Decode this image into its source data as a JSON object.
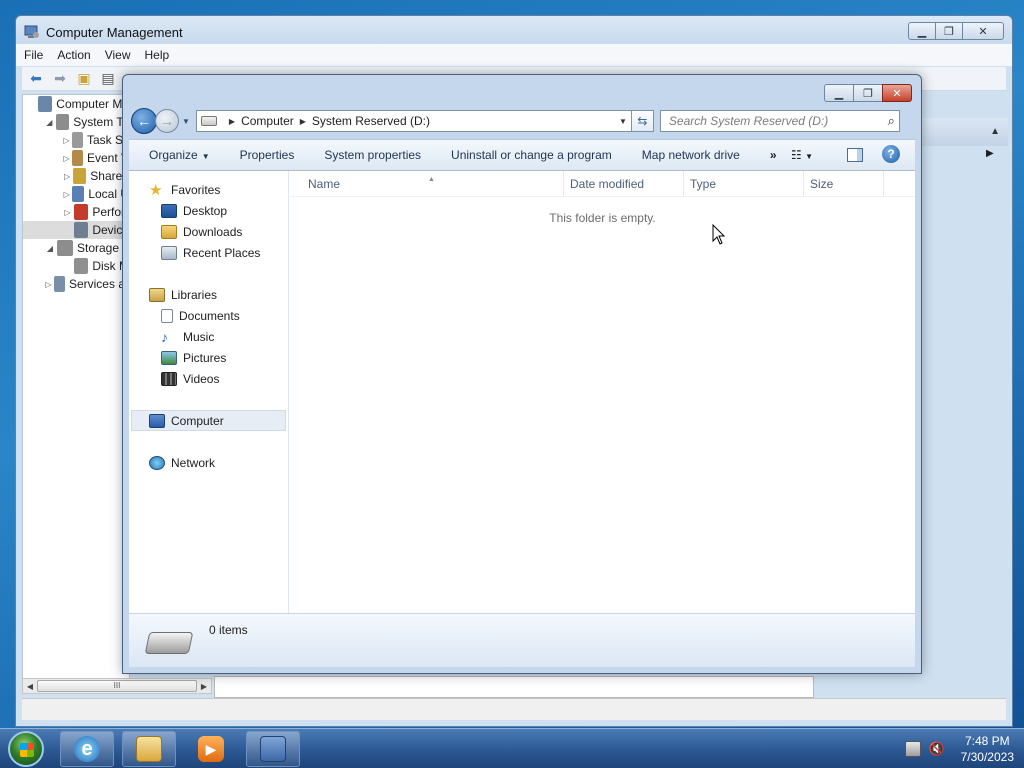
{
  "cm": {
    "title": "Computer Management",
    "menu": [
      "File",
      "Action",
      "View",
      "Help"
    ],
    "tree": [
      {
        "label": "Computer Ma",
        "level": 0,
        "exp": "",
        "color": "#6b86a6"
      },
      {
        "label": "System To",
        "level": 1,
        "exp": "◢",
        "color": "#8d8d8d"
      },
      {
        "label": "Task Sc",
        "level": 2,
        "exp": "▷",
        "color": "#9a9a9a"
      },
      {
        "label": "Event V",
        "level": 2,
        "exp": "▷",
        "color": "#b48a4a"
      },
      {
        "label": "Shared",
        "level": 2,
        "exp": "▷",
        "color": "#c9a43a"
      },
      {
        "label": "Local U",
        "level": 2,
        "exp": "▷",
        "color": "#5a7fb5"
      },
      {
        "label": "Perforr",
        "level": 2,
        "exp": "▷",
        "color": "#c43b2b"
      },
      {
        "label": "Device",
        "level": 2,
        "exp": "",
        "color": "#6f7f92",
        "selected": true
      },
      {
        "label": "Storage",
        "level": 1,
        "exp": "◢",
        "color": "#8d8d8d"
      },
      {
        "label": "Disk M",
        "level": 2,
        "exp": "",
        "color": "#909090"
      },
      {
        "label": "Services ar",
        "level": 1,
        "exp": "▷",
        "color": "#7a8ea8"
      }
    ],
    "scroll_thumb": "III"
  },
  "explorer": {
    "address": [
      "Computer",
      "System Reserved (D:)"
    ],
    "search_placeholder": "Search System Reserved (D:)",
    "commands": {
      "organize": "Organize",
      "properties": "Properties",
      "system_properties": "System properties",
      "uninstall": "Uninstall or change a program",
      "map_drive": "Map network drive",
      "more": "»"
    },
    "nav": {
      "favorites": "Favorites",
      "desktop": "Desktop",
      "downloads": "Downloads",
      "recent": "Recent Places",
      "libraries": "Libraries",
      "documents": "Documents",
      "music": "Music",
      "pictures": "Pictures",
      "videos": "Videos",
      "computer": "Computer",
      "network": "Network"
    },
    "columns": {
      "name": "Name",
      "date": "Date modified",
      "type": "Type",
      "size": "Size"
    },
    "empty_text": "This folder is empty.",
    "details": "0 items"
  },
  "taskbar": {
    "time": "7:48 PM",
    "date": "7/30/2023"
  },
  "colors": {
    "accent": "#1d5ea8",
    "taskbar": "#2a5590",
    "selection": "#e6edf5"
  }
}
